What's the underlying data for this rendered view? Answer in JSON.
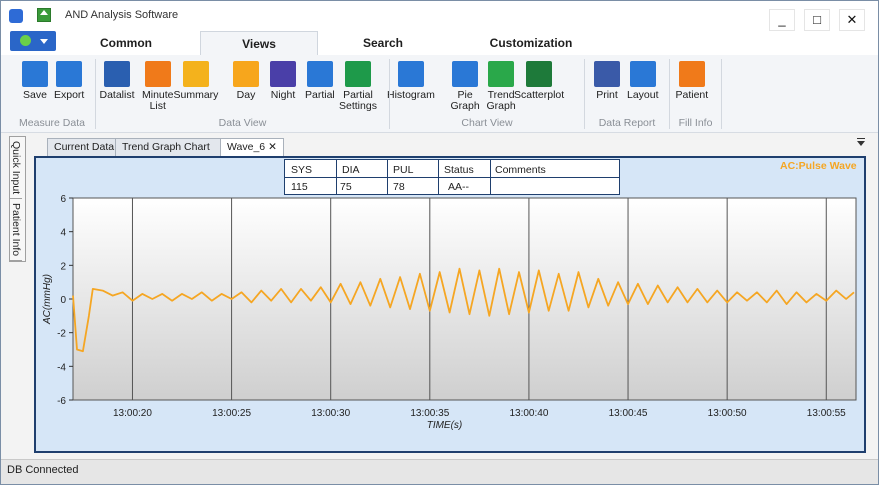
{
  "window": {
    "title": "AND Analysis Software",
    "minimize": "_",
    "maximize": "□",
    "close": "✕"
  },
  "ribbon": {
    "tabs": [
      "Common",
      "Views",
      "Search",
      "Customization"
    ],
    "buttons": [
      {
        "label": "Save",
        "icon": "save-icon",
        "color": "#2a78d6"
      },
      {
        "label": "Export",
        "icon": "export-icon",
        "color": "#2a78d6"
      },
      {
        "label": "Datalist",
        "icon": "datalist-icon",
        "color": "#2a5fb0"
      },
      {
        "label": "Minute\nList",
        "icon": "minute-list-icon",
        "color": "#f07a1a"
      },
      {
        "label": "Summary",
        "icon": "summary-icon",
        "color": "#f4b21c"
      },
      {
        "label": "Day",
        "icon": "sun-icon",
        "color": "#f7a61c"
      },
      {
        "label": "Night",
        "icon": "moon-icon",
        "color": "#4a3fa8"
      },
      {
        "label": "Partial",
        "icon": "clock-icon",
        "color": "#2a78d6"
      },
      {
        "label": "Partial\nSettings",
        "icon": "partial-settings-icon",
        "color": "#1e9a4a"
      },
      {
        "label": "Histogram",
        "icon": "histogram-icon",
        "color": "#2a78d6"
      },
      {
        "label": "Pie\nGraph",
        "icon": "pie-graph-icon",
        "color": "#2a78d6"
      },
      {
        "label": "Trend\nGraph",
        "icon": "trend-graph-icon",
        "color": "#2aa84a"
      },
      {
        "label": "Scatterplot",
        "icon": "scatterplot-icon",
        "color": "#1e7a3a"
      },
      {
        "label": "Print",
        "icon": "print-icon",
        "color": "#3a5aa8"
      },
      {
        "label": "Layout",
        "icon": "layout-icon",
        "color": "#2a78d6"
      },
      {
        "label": "Patient",
        "icon": "patient-icon",
        "color": "#f07a1a"
      }
    ],
    "groups": [
      "Measure Data",
      "Data View",
      "Chart View",
      "Data Report",
      "Fill Info"
    ]
  },
  "side_tabs": [
    "Quick Input",
    "Patient Info"
  ],
  "doc_tabs": [
    "Current Data",
    "Trend Graph Chart",
    "Wave_6"
  ],
  "doc_close": "✕",
  "stats": {
    "headers": [
      "SYS",
      "DIA",
      "PUL",
      "Status",
      "Comments"
    ],
    "values": [
      "115",
      "75",
      "78",
      "AA--",
      ""
    ]
  },
  "series_label": "AC:Pulse Wave",
  "chart_data": {
    "type": "line",
    "xlabel": "TIME(s)",
    "ylabel": "AC(mmHg)",
    "ylim": [
      -6,
      6
    ],
    "yticks": [
      "6",
      "4",
      "2",
      "0",
      "-2",
      "-4",
      "-6"
    ],
    "xticks": [
      "13:00:20",
      "13:00:25",
      "13:00:30",
      "13:00:35",
      "13:00:40",
      "13:00:45",
      "13:00:50",
      "13:00:55"
    ],
    "xlim_seconds": [
      17,
      56.5
    ],
    "series": [
      {
        "color": "#f5a623",
        "x": [
          17.0,
          17.2,
          17.5,
          17.8,
          18.0,
          18.5,
          19.0,
          19.5,
          20.0,
          20.5,
          21.0,
          21.5,
          22.0,
          22.5,
          23.0,
          23.5,
          24.0,
          24.5,
          25.0,
          25.5,
          26.0,
          26.5,
          27.0,
          27.5,
          28.0,
          28.5,
          29.0,
          29.5,
          30.0,
          30.5,
          31.0,
          31.5,
          32.0,
          32.5,
          33.0,
          33.5,
          34.0,
          34.5,
          35.0,
          35.5,
          36.0,
          36.5,
          37.0,
          37.5,
          38.0,
          38.5,
          39.0,
          39.5,
          40.0,
          40.5,
          41.0,
          41.5,
          42.0,
          42.5,
          43.0,
          43.5,
          44.0,
          44.5,
          45.0,
          45.5,
          46.0,
          46.5,
          47.0,
          47.5,
          48.0,
          48.5,
          49.0,
          49.5,
          50.0,
          50.5,
          51.0,
          51.5,
          52.0,
          52.5,
          53.0,
          53.5,
          54.0,
          54.5,
          55.0,
          55.5,
          56.0,
          56.4
        ],
        "y": [
          0.2,
          -3.0,
          -3.1,
          -1.0,
          0.6,
          0.5,
          0.2,
          0.4,
          -0.1,
          0.3,
          0.0,
          0.3,
          -0.1,
          0.3,
          0.0,
          0.4,
          -0.1,
          0.3,
          0.0,
          0.4,
          -0.2,
          0.5,
          -0.1,
          0.6,
          -0.2,
          0.6,
          -0.1,
          0.7,
          -0.2,
          0.9,
          -0.3,
          1.0,
          -0.4,
          1.2,
          -0.5,
          1.3,
          -0.6,
          1.5,
          -0.7,
          1.6,
          -0.8,
          1.8,
          -0.9,
          1.7,
          -1.0,
          1.8,
          -0.9,
          1.6,
          -0.8,
          1.7,
          -0.7,
          1.5,
          -0.7,
          1.6,
          -0.5,
          1.2,
          -0.4,
          1.0,
          -0.3,
          0.9,
          -0.3,
          0.8,
          -0.2,
          0.7,
          -0.2,
          0.6,
          -0.2,
          0.5,
          -0.2,
          0.4,
          -0.1,
          0.4,
          -0.2,
          0.5,
          -0.3,
          0.4,
          -0.2,
          0.3,
          -0.1,
          0.5,
          0.0,
          0.4
        ]
      }
    ]
  },
  "status_bar": "DB Connected"
}
